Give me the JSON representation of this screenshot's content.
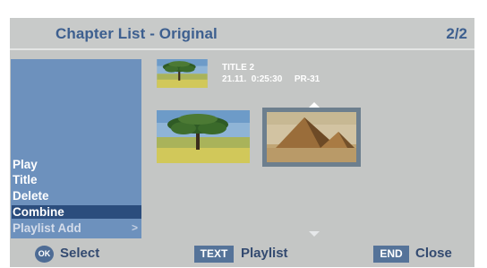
{
  "header": {
    "title": "Chapter List - Original",
    "page_indicator": "2/2"
  },
  "menu": {
    "items": [
      {
        "label": "Play",
        "state": "normal"
      },
      {
        "label": "Title",
        "state": "normal"
      },
      {
        "label": "Delete",
        "state": "normal"
      },
      {
        "label": "Combine",
        "state": "selected"
      },
      {
        "label": "Playlist Add",
        "state": "dimmed",
        "submenu_arrow": ">"
      }
    ]
  },
  "title_info": {
    "name": "TITLE 2",
    "date_time": "21.11.  0:25:30",
    "program": "PR-31"
  },
  "chapters": [
    {
      "thumbnail": "tree-landscape",
      "selected": false
    },
    {
      "thumbnail": "pyramids-landscape",
      "selected": true
    }
  ],
  "footer": {
    "ok_key": "OK",
    "ok_label": "Select",
    "text_key": "TEXT",
    "text_label": "Playlist",
    "end_key": "END",
    "end_label": "Close"
  },
  "colors": {
    "panel_bg": "#c4c6c5",
    "menu_bg": "#6d91bd",
    "menu_selected": "#2b4d7d",
    "title_text": "#3d5f8f",
    "key_badge": "#557399"
  },
  "icons": [
    "up-arrow-icon",
    "down-arrow-icon",
    "submenu-arrow-icon"
  ]
}
